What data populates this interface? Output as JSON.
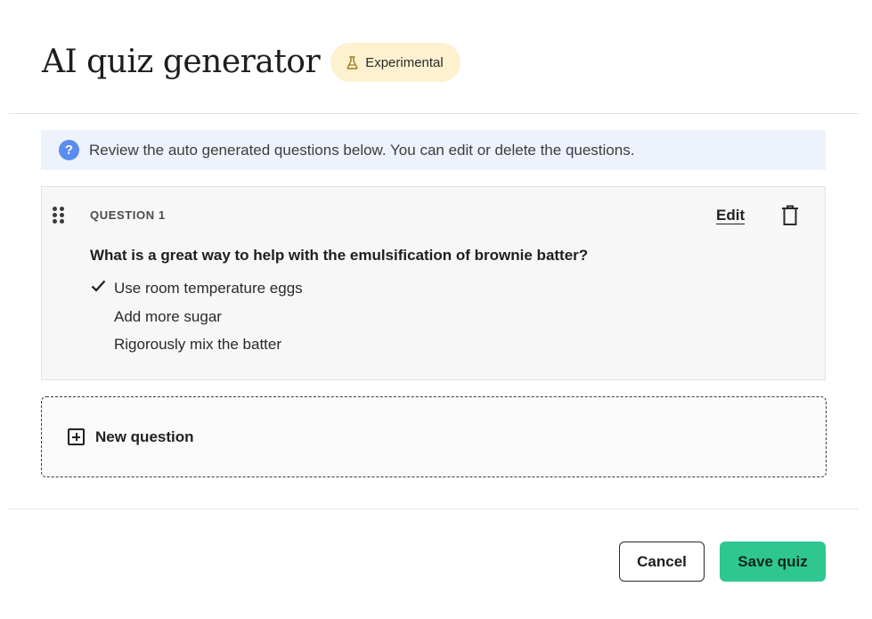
{
  "header": {
    "title": "AI quiz generator",
    "badge": {
      "label": "Experimental",
      "icon": "flask-icon",
      "color": "#fdf1cf"
    }
  },
  "info_banner": {
    "icon": "question-circle-icon",
    "text": "Review the auto generated questions below. You can edit or delete the questions.",
    "background": "#eef2fc"
  },
  "question": {
    "label": "QUESTION 1",
    "edit_label": "Edit",
    "text": "What is a great way to help with the emulsification of brownie batter?",
    "answers": [
      {
        "text": "Use room temperature eggs",
        "correct": true
      },
      {
        "text": "Add more sugar",
        "correct": false
      },
      {
        "text": "Rigorously mix the batter",
        "correct": false
      }
    ]
  },
  "new_question": {
    "label": "New question",
    "icon": "plus-square-icon"
  },
  "footer": {
    "cancel_label": "Cancel",
    "save_label": "Save quiz",
    "save_color": "#2ec78f"
  }
}
